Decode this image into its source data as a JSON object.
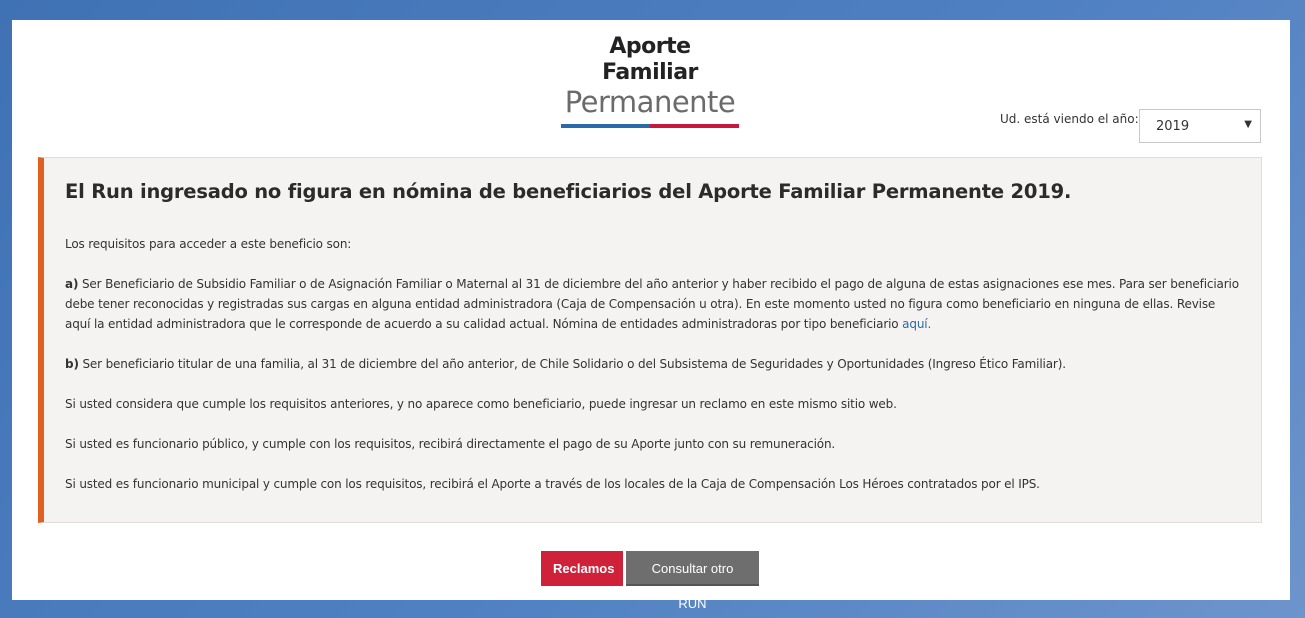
{
  "logo": {
    "line1": "Aporte Familiar",
    "line2": "Permanente"
  },
  "year_selector": {
    "label": "Ud. está viendo el año:",
    "value": "2019"
  },
  "alert": {
    "title": "El Run ingresado no figura en nómina de beneficiarios del Aporte Familiar Permanente 2019.",
    "intro": "Los requisitos para acceder a este beneficio son:",
    "a_label": "a)",
    "a_text": " Ser Beneficiario de Subsidio Familiar o de Asignación Familiar o Maternal al 31 de diciembre del año anterior y haber recibido el pago de alguna de estas asignaciones ese mes. Para ser beneficiario debe tener reconocidas y registradas sus cargas en alguna entidad administradora (Caja de Compensación u otra). En este momento usted no figura como beneficiario en ninguna de ellas. Revise aquí la entidad administradora que le corresponde de acuerdo a su calidad actual. Nómina de entidades administradoras por tipo beneficiario ",
    "a_link": "aquí.",
    "b_label": "b)",
    "b_text": " Ser beneficiario titular de una familia, al 31 de diciembre del año anterior, de Chile Solidario o del Subsistema de Seguridades y Oportunidades (Ingreso Ético Familiar).",
    "p_reclamo": "Si usted considera que cumple los requisitos anteriores, y no aparece como beneficiario, puede ingresar un reclamo en este mismo sitio web.",
    "p_funcionario": "Si usted es funcionario público, y cumple con los requisitos, recibirá directamente el pago de su Aporte junto con su remuneración.",
    "p_municipal": "Si usted es funcionario municipal y cumple con los requisitos, recibirá el Aporte a través de los locales de la Caja de Compensación Los Héroes contratados por el IPS."
  },
  "buttons": {
    "reclamos": "Reclamos",
    "otro_run": "Consultar otro RUN"
  },
  "colors": {
    "accent_orange": "#e06021",
    "red": "#d0213a",
    "blue": "#2a6aa8",
    "gray_button": "#6e6e6e"
  }
}
